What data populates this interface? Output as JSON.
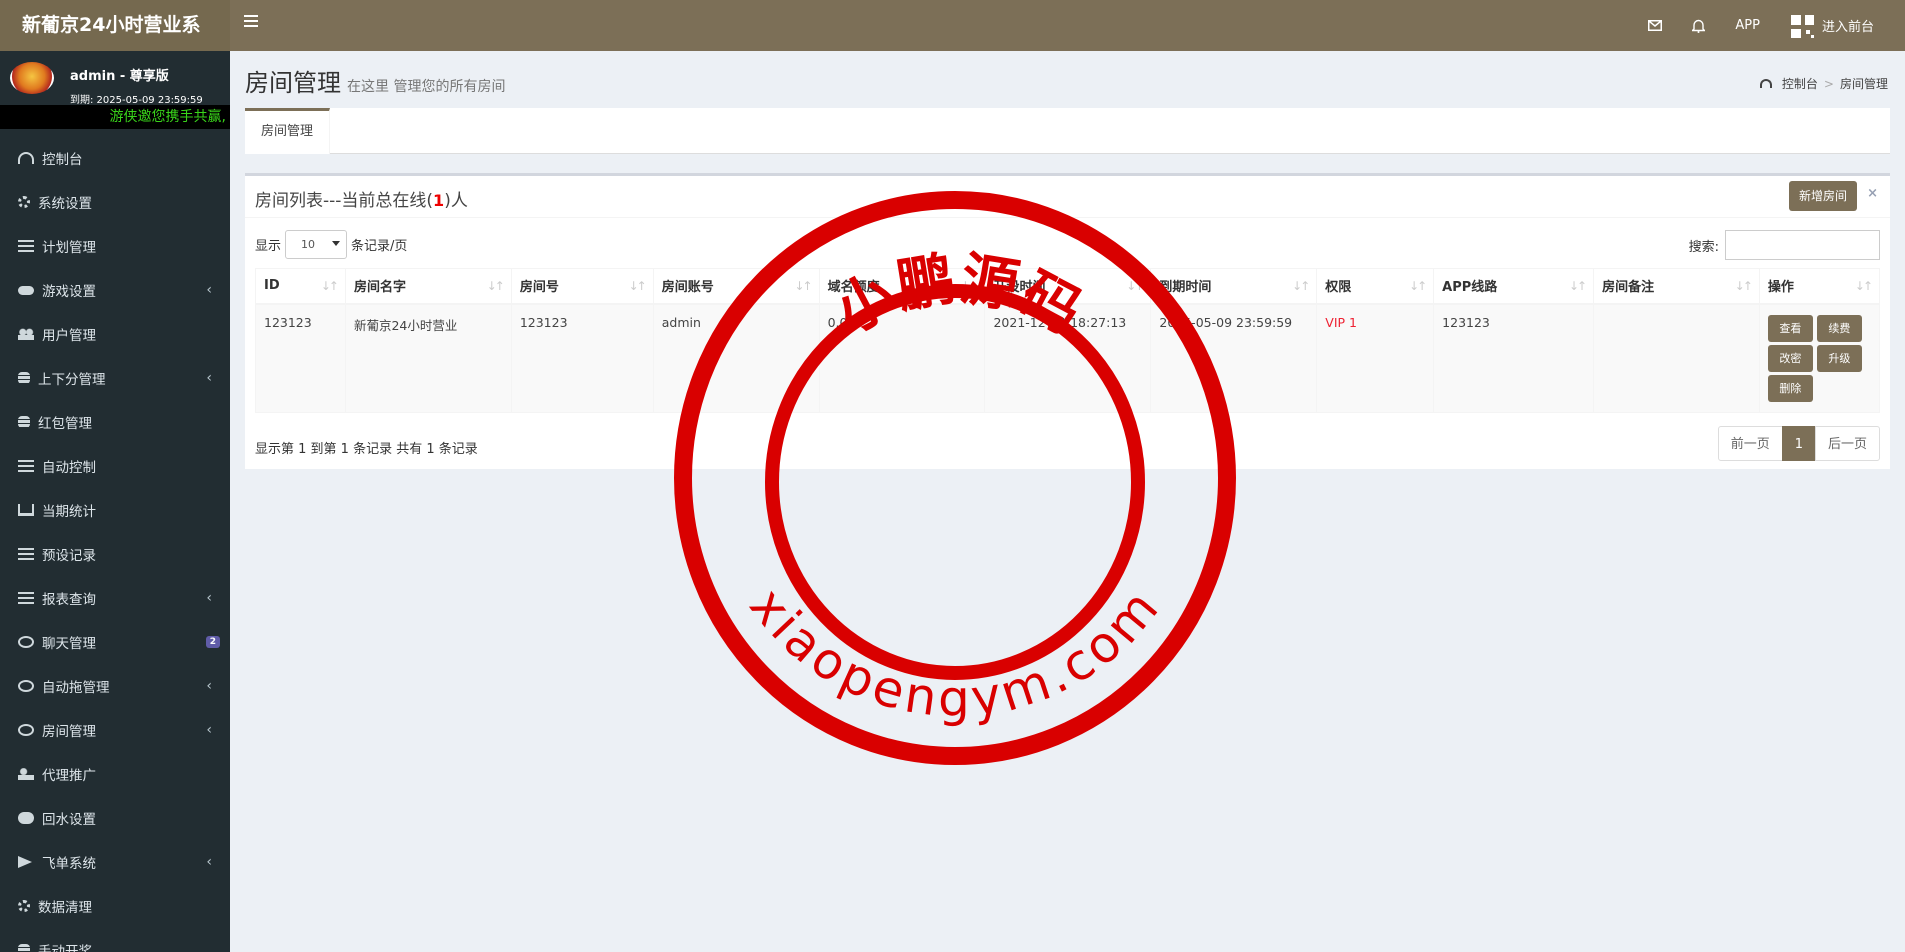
{
  "header": {
    "logo": "新葡京24小时营业系",
    "app_label": "APP",
    "frontend_label": "进入前台",
    "icons": [
      "menu-icon",
      "mail-icon",
      "bell-icon",
      "qr-code-icon"
    ]
  },
  "sidebar": {
    "user_name": "admin - 尊享版",
    "expire_label": "到期: 2025-05-09 23:59:59",
    "marquee": "游侠邀您携手共赢,",
    "items": [
      {
        "label": "控制台",
        "icon": "dashboard-icon"
      },
      {
        "label": "系统设置",
        "icon": "gears-icon"
      },
      {
        "label": "计划管理",
        "icon": "list-icon"
      },
      {
        "label": "游戏设置",
        "icon": "gamepad-icon"
      },
      {
        "label": "用户管理",
        "icon": "users-icon"
      },
      {
        "label": "上下分管理",
        "icon": "database-icon"
      },
      {
        "label": "红包管理",
        "icon": "database-icon"
      },
      {
        "label": "自动控制",
        "icon": "list-icon"
      },
      {
        "label": "当期统计",
        "icon": "cart-icon"
      },
      {
        "label": "预设记录",
        "icon": "list-icon"
      },
      {
        "label": "报表查询",
        "icon": "list-icon"
      },
      {
        "label": "聊天管理",
        "icon": "chat-icon",
        "badge": "2"
      },
      {
        "label": "自动拖管理",
        "icon": "chat-icon"
      },
      {
        "label": "房间管理",
        "icon": "chat-icon"
      },
      {
        "label": "代理推广",
        "icon": "user-plus-icon"
      },
      {
        "label": "回水设置",
        "icon": "cloud-icon"
      },
      {
        "label": "飞单系统",
        "icon": "plane-icon"
      },
      {
        "label": "数据清理",
        "icon": "gear-icon"
      },
      {
        "label": "手动开奖",
        "icon": "lock-icon"
      }
    ]
  },
  "page": {
    "title": "房间管理",
    "subtitle": "在这里 管理您的所有房间",
    "breadcrumb": [
      "控制台",
      "房间管理"
    ],
    "tab": "房间管理"
  },
  "box": {
    "title_prefix": "房间列表---当前总在线(",
    "online_count": "1",
    "title_suffix": ")人",
    "add_button": "新增房间",
    "close": "×",
    "length_prefix": "显示",
    "length_value": "10",
    "length_suffix": "条记录/页",
    "search_label": "搜索:",
    "search_value": ""
  },
  "table": {
    "headers": [
      "ID",
      "房间名字",
      "房间号",
      "房间账号",
      "域名额度",
      "开设时间",
      "到期时间",
      "权限",
      "APP线路",
      "房间备注",
      "操作"
    ],
    "rows": [
      {
        "id": "123123",
        "name": "新葡京24小时营业",
        "room_no": "123123",
        "account": "admin",
        "quota": "0.00",
        "open_time": "2021-12-14 18:27:13",
        "expire_time": "2025-05-09 23:59:59",
        "permission": "VIP 1",
        "app_line": "123123",
        "remark": "",
        "actions": [
          "查看",
          "续费",
          "改密",
          "升级",
          "删除"
        ]
      }
    ]
  },
  "footer": {
    "info": "显示第 1 到第 1 条记录 共有 1 条记录",
    "prev": "前一页",
    "page": "1",
    "next": "后一页"
  },
  "watermark": {
    "text_top": "小鹏源码",
    "text_bottom": "xiaopengym.com",
    "color": "#d90000"
  },
  "colors": {
    "brand": "#7c6f57",
    "sidebar": "#222d32",
    "accent_red": "#e00000"
  }
}
